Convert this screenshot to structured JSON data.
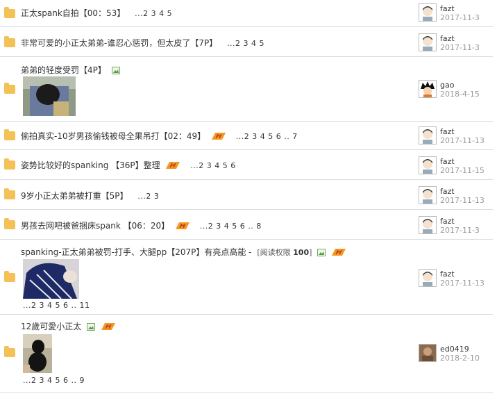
{
  "threads": [
    {
      "title": "正太spank自拍【00：53】",
      "pages": "...2 3 4 5",
      "user": "fazt",
      "date": "2017-11-3"
    },
    {
      "title": "非常可爱的小正太弟弟-谁忍心惩罚，但太皮了【7P】",
      "pages": "...2 3 4 5",
      "user": "fazt",
      "date": "2017-11-3"
    },
    {
      "title": "弟弟的轻度受罚【4P】",
      "user": "gao",
      "date": "2018-4-15"
    },
    {
      "title": "偷拍真实-10岁男孩偷钱被母全果吊打【02：49】",
      "pages": "...2 3 4 5 6 .. 7",
      "user": "fazt",
      "date": "2017-11-13"
    },
    {
      "title": "姿势比较好的spanking 【36P】整理",
      "pages": "...2 3 4 5 6",
      "user": "fazt",
      "date": "2017-11-15"
    },
    {
      "title": "9岁小正太弟弟被打重【5P】",
      "pages": "...2 3",
      "user": "fazt",
      "date": "2017-11-13"
    },
    {
      "title": "男孩去网吧被爸捆床spank 【06：20】",
      "pages": "...2 3 4 5 6 .. 8",
      "user": "fazt",
      "date": "2017-11-3"
    },
    {
      "title": "spanking-正太弟弟被罚-打手、大腿pp【207P】有亮点高能 - ",
      "perm_label": "[阅读权限",
      "perm_value": "100",
      "perm_close": "]",
      "pages": "...2 3 4 5 6 .. 11",
      "user": "fazt",
      "date": "2017-11-13"
    },
    {
      "title": "12歲可愛小正太",
      "pages": "...2 3 4 5 6 .. 9",
      "user": "ed0419",
      "date": "2018-2-10"
    }
  ],
  "colors": {
    "folder": "#f3c156",
    "hot": "#f39a1e",
    "divider": "#d7dde3",
    "date": "#999999"
  },
  "icons": [
    "folder-icon",
    "hot-icon",
    "image-attachment-icon"
  ]
}
